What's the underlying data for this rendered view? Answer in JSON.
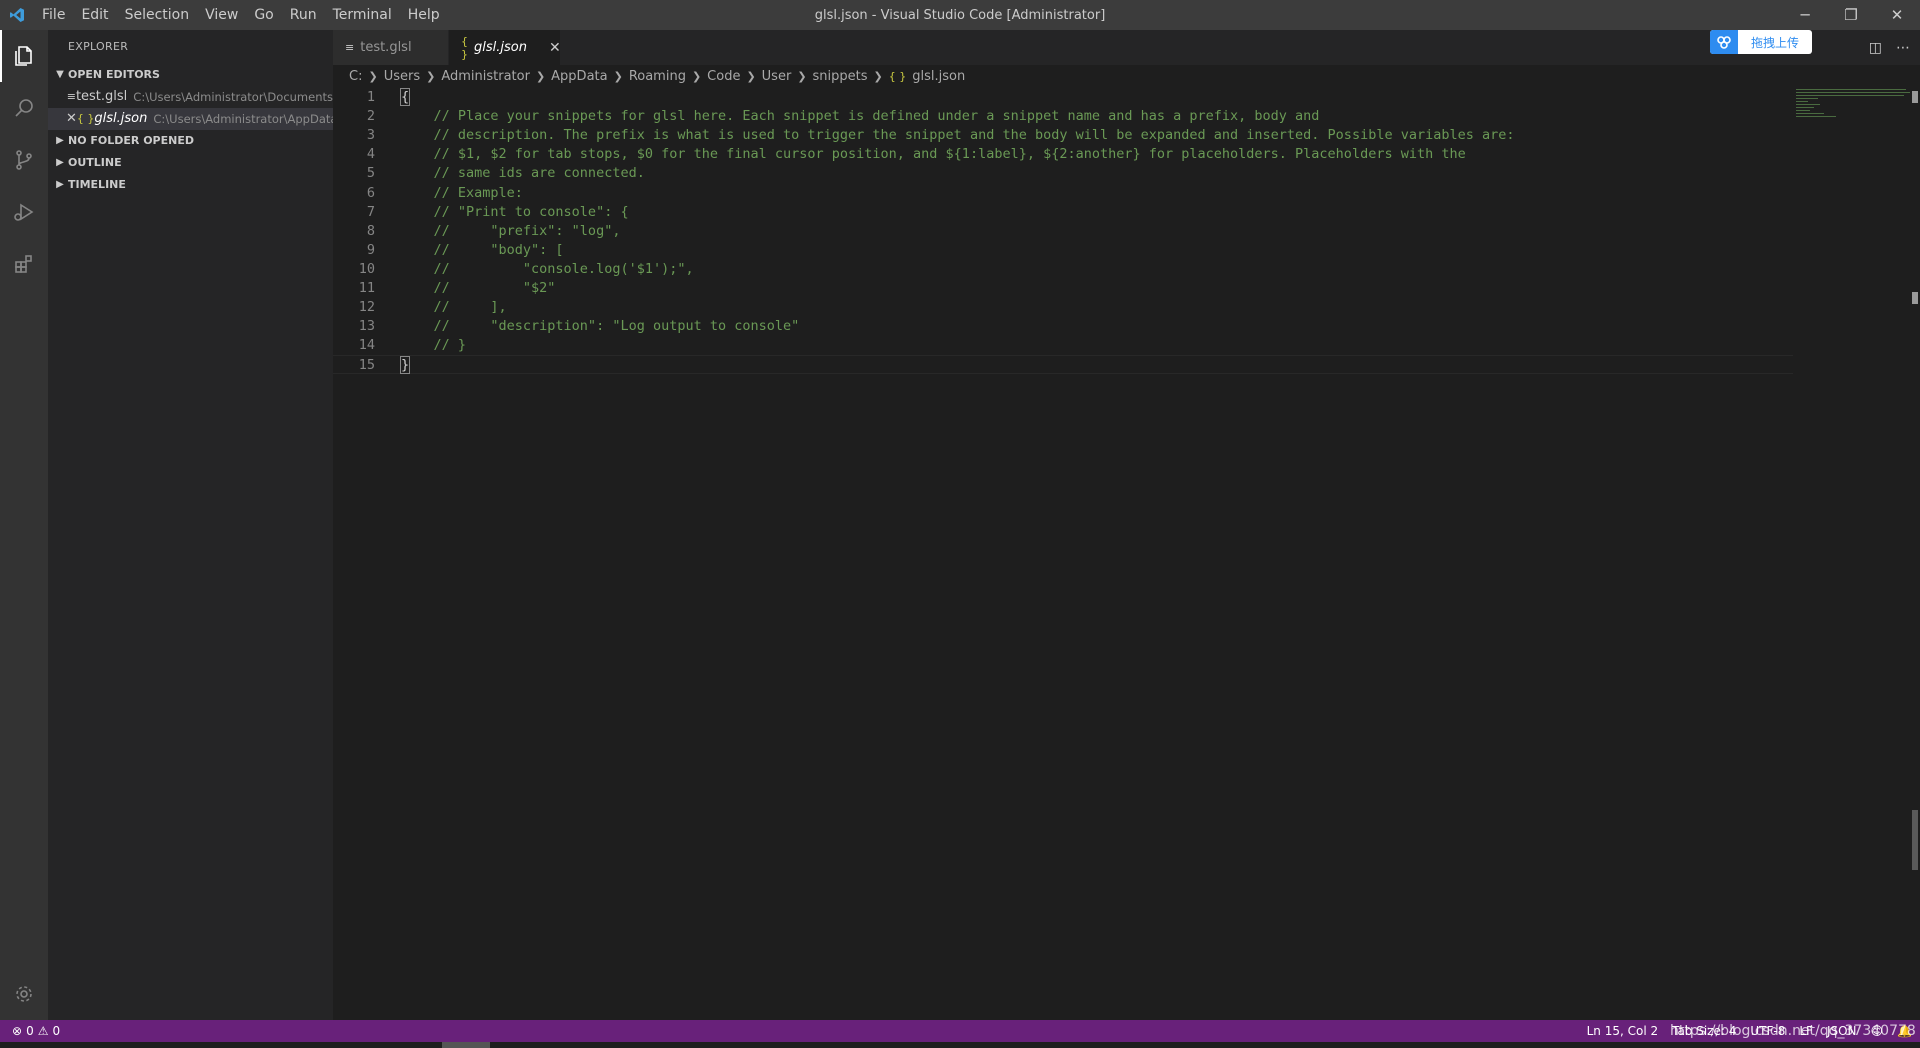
{
  "titlebar": {
    "menu": [
      "File",
      "Edit",
      "Selection",
      "View",
      "Go",
      "Run",
      "Terminal",
      "Help"
    ],
    "title": "glsl.json - Visual Studio Code [Administrator]",
    "controls": [
      "─",
      "❐",
      "✕"
    ]
  },
  "activity": {
    "icons": [
      "explorer-icon",
      "search-icon",
      "source-control-icon",
      "run-debug-icon",
      "extensions-icon",
      "gear-icon"
    ]
  },
  "sidebar": {
    "title": "EXPLORER",
    "sections": {
      "open_editors": "OPEN EDITORS",
      "no_folder": "NO FOLDER OPENED",
      "outline": "OUTLINE",
      "timeline": "TIMELINE"
    },
    "open_editors": [
      {
        "name": "test.glsl",
        "path": "C:\\Users\\Administrator\\Documents"
      },
      {
        "name": "glsl.json",
        "path": "C:\\Users\\Administrator\\AppData..."
      }
    ]
  },
  "tabs": [
    {
      "label": "test.glsl",
      "icon": "≡"
    },
    {
      "label": "glsl.json",
      "icon": "{ }"
    }
  ],
  "upload": {
    "label": "拖拽上传"
  },
  "breadcrumb": [
    "C:",
    "Users",
    "Administrator",
    "AppData",
    "Roaming",
    "Code",
    "User",
    "snippets",
    "glsl.json"
  ],
  "editor": {
    "lines": [
      {
        "n": "1",
        "text": "{"
      },
      {
        "n": "2",
        "text": "\t// Place your snippets for glsl here. Each snippet is defined under a snippet name and has a prefix, body and"
      },
      {
        "n": "3",
        "text": "\t// description. The prefix is what is used to trigger the snippet and the body will be expanded and inserted. Possible variables are:"
      },
      {
        "n": "4",
        "text": "\t// $1, $2 for tab stops, $0 for the final cursor position, and ${1:label}, ${2:another} for placeholders. Placeholders with the"
      },
      {
        "n": "5",
        "text": "\t// same ids are connected."
      },
      {
        "n": "6",
        "text": "\t// Example:"
      },
      {
        "n": "7",
        "text": "\t// \"Print to console\": {"
      },
      {
        "n": "8",
        "text": "\t// \t\"prefix\": \"log\","
      },
      {
        "n": "9",
        "text": "\t// \t\"body\": ["
      },
      {
        "n": "10",
        "text": "\t// \t\t\"console.log('$1');\","
      },
      {
        "n": "11",
        "text": "\t// \t\t\"$2\""
      },
      {
        "n": "12",
        "text": "\t// \t],"
      },
      {
        "n": "13",
        "text": "\t// \t\"description\": \"Log output to console\""
      },
      {
        "n": "14",
        "text": "\t// }"
      },
      {
        "n": "15",
        "text": "}"
      }
    ]
  },
  "status": {
    "errors": "0",
    "warnings": "0",
    "right": [
      "Ln 15, Col 2",
      "Tab Size: 4",
      "UTF-8",
      "LF",
      "JSON",
      "😊",
      "🔔"
    ],
    "watermark": "https://blog.csdn.net/qq_37340778"
  },
  "colors": {
    "statusbar": "#68217a",
    "comment": "#6a9955",
    "json_icon": "#cbcb41"
  }
}
